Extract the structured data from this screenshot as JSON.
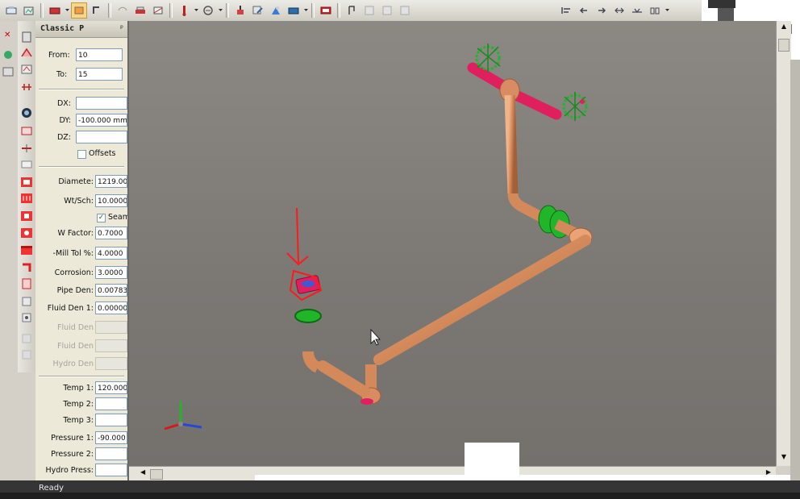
{
  "toolbar": {
    "icons": [
      "zoom-icon",
      "pan-icon",
      "print-icon",
      "select-icon",
      "rotate-icon",
      "undo-icon",
      "redo-icon",
      "plot-icon",
      "anchor-icon",
      "restraint-icon",
      "hanger-icon",
      "wind-icon",
      "report-icon",
      "window-icon",
      "align-left-icon",
      "align-center-icon",
      "align-right-icon",
      "distribute-icon",
      "group-icon"
    ]
  },
  "panel": {
    "title": "Classic P",
    "from_label": "From:",
    "from_value": "10",
    "to_label": "To:",
    "to_value": "15",
    "dx_label": "DX:",
    "dx_value": "",
    "dy_label": "DY:",
    "dy_value": "-100.000 mm",
    "dz_label": "DZ:",
    "dz_value": "",
    "offsets_label": "Offsets",
    "diameter_label": "Diamete:",
    "diameter_value": "1219.00",
    "wtsch_label": "Wt/Sch:",
    "wtsch_value": "10.0000",
    "seam_label": "Seam",
    "wfactor_label": "W Factor:",
    "wfactor_value": "0.7000",
    "milltol_label": "-Mill Tol %:",
    "milltol_value": "4.0000",
    "corrosion_label": "Corrosion:",
    "corrosion_value": "3.0000",
    "pipeden_label": "Pipe Den:",
    "pipeden_value": "0.00783",
    "fluidden_label": "Fluid Den 1:",
    "fluidden_value": "0.00000",
    "fluidden2_label": "Fluid Den",
    "fluidden3_label": "Fluid Den",
    "hydroden_label": "Hydro Den",
    "temp1_label": "Temp 1:",
    "temp1_value": "120.000",
    "temp2_label": "Temp 2:",
    "temp2_value": "",
    "temp3_label": "Temp 3:",
    "temp3_value": "",
    "pressure1_label": "Pressure 1:",
    "pressure1_value": "-90.000",
    "pressure2_label": "Pressure 2:",
    "pressure2_value": "",
    "hydro_label": "Hydro Press:",
    "hydro_value": ""
  },
  "status": {
    "text": "Ready"
  },
  "colors": {
    "pipe": "#d4895a",
    "flange_red": "#e0205e",
    "restraint_green": "#21b52a",
    "annotation_red": "#ff1a1a",
    "viewport_bg": "#7f7c78"
  }
}
